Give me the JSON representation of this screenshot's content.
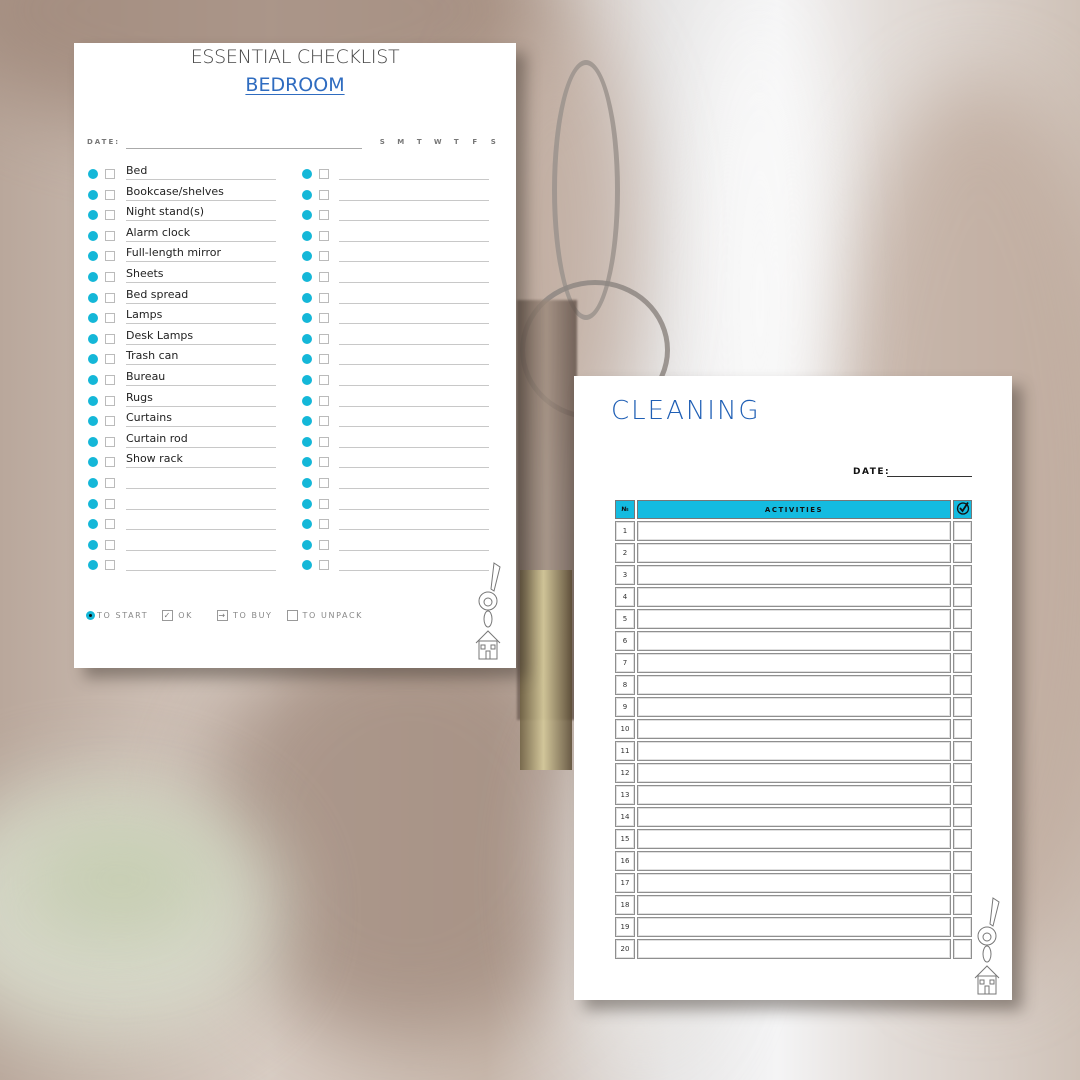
{
  "bedroom_checklist": {
    "title": "ESSENTIAL CHECKLIST",
    "subtitle": "BEDROOM",
    "date_label": "DATE:",
    "days": [
      "S",
      "M",
      "T",
      "W",
      "T",
      "F",
      "S"
    ],
    "left_items": [
      "Bed",
      "Bookcase/shelves",
      "Night stand(s)",
      "Alarm clock",
      "Full-length mirror",
      "Sheets",
      "Bed spread",
      "Lamps",
      "Desk Lamps",
      "Trash can",
      "Bureau",
      "Rugs",
      "Curtains",
      "Curtain rod",
      "Show rack",
      "",
      "",
      "",
      "",
      ""
    ],
    "right_items": [
      "",
      "",
      "",
      "",
      "",
      "",
      "",
      "",
      "",
      "",
      "",
      "",
      "",
      "",
      "",
      "",
      "",
      "",
      "",
      ""
    ],
    "legend": [
      {
        "icon": "filled-dot-icon",
        "label": "TO START"
      },
      {
        "icon": "checked-box-icon",
        "label": "OK"
      },
      {
        "icon": "arrow-box-icon",
        "label": "TO BUY"
      },
      {
        "icon": "empty-box-icon",
        "label": "TO UNPACK"
      }
    ],
    "accent_color": "#14b7d8",
    "subtitle_color": "#2f6cc0"
  },
  "cleaning": {
    "title": "CLEANING",
    "date_label": "DATE:",
    "table": {
      "headers": {
        "number": "№",
        "activities": "ACTIVITIES",
        "done": "✓"
      },
      "rows": [
        "1",
        "2",
        "3",
        "4",
        "5",
        "6",
        "7",
        "8",
        "9",
        "10",
        "11",
        "12",
        "13",
        "14",
        "15",
        "16",
        "17",
        "18",
        "19",
        "20"
      ]
    },
    "header_color": "#14bbe0",
    "title_color": "#1f5fb5"
  }
}
